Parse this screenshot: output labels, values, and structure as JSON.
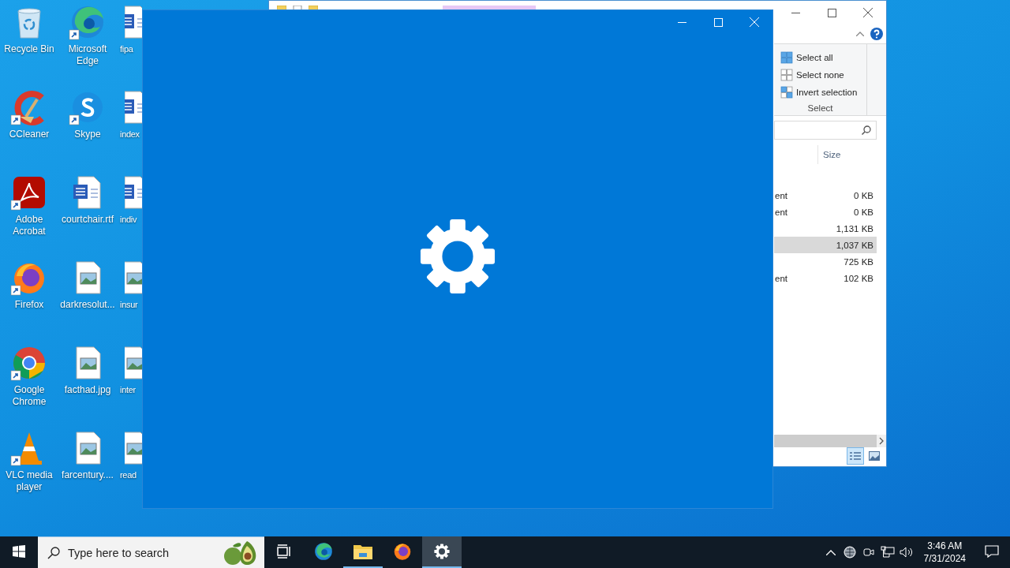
{
  "desktop": {
    "columns": [
      [
        {
          "label": "Recycle Bin",
          "kind": "recycle",
          "shortcut": false
        },
        {
          "label": "CCleaner",
          "kind": "ccleaner",
          "shortcut": true
        },
        {
          "label": "Adobe Acrobat",
          "kind": "acrobat",
          "shortcut": true
        },
        {
          "label": "Firefox",
          "kind": "firefox",
          "shortcut": true
        },
        {
          "label": "Google Chrome",
          "kind": "chrome",
          "shortcut": true
        },
        {
          "label": "VLC media player",
          "kind": "vlc",
          "shortcut": true
        }
      ],
      [
        {
          "label": "Microsoft Edge",
          "kind": "edge",
          "shortcut": true
        },
        {
          "label": "Skype",
          "kind": "skype",
          "shortcut": true
        },
        {
          "label": "courtchair.rtf",
          "kind": "word",
          "shortcut": false
        },
        {
          "label": "darkresolut...",
          "kind": "image",
          "shortcut": false
        },
        {
          "label": "facthad.jpg",
          "kind": "image",
          "shortcut": false
        },
        {
          "label": "farcentury....",
          "kind": "image",
          "shortcut": false
        }
      ],
      [
        {
          "label": "fipa",
          "kind": "word",
          "shortcut": false
        },
        {
          "label": "index",
          "kind": "word",
          "shortcut": false
        },
        {
          "label": "indiv",
          "kind": "word",
          "shortcut": false
        },
        {
          "label": "insur",
          "kind": "image",
          "shortcut": false
        },
        {
          "label": "inter",
          "kind": "image",
          "shortcut": false
        },
        {
          "label": "read",
          "kind": "image",
          "shortcut": false
        }
      ]
    ]
  },
  "explorer": {
    "ribbon": {
      "commands": [
        {
          "label": "Select all",
          "kind": "all"
        },
        {
          "label": "Select none",
          "kind": "none"
        },
        {
          "label": "Invert selection",
          "kind": "invert"
        }
      ],
      "group": "Select"
    },
    "column_header": "Size",
    "rows": [
      {
        "type": "ent",
        "size": "0 KB",
        "selected": false
      },
      {
        "type": "ent",
        "size": "0 KB",
        "selected": false
      },
      {
        "size": "1,131 KB",
        "selected": false
      },
      {
        "size": "1,037 KB",
        "selected": true
      },
      {
        "size": "725 KB",
        "selected": false
      },
      {
        "type": "ent",
        "size": "102 KB",
        "selected": false
      }
    ]
  },
  "taskbar": {
    "search": {
      "placeholder": "Type here to search"
    },
    "apps": [
      {
        "kind": "taskview",
        "running": false,
        "selected": false
      },
      {
        "kind": "edge",
        "running": false,
        "selected": false
      },
      {
        "kind": "explorer",
        "running": true,
        "selected": false
      },
      {
        "kind": "firefox",
        "running": false,
        "selected": false
      },
      {
        "kind": "settings",
        "running": true,
        "selected": true
      }
    ],
    "clock": {
      "time": "3:46 AM",
      "date": "7/31/2024"
    }
  }
}
